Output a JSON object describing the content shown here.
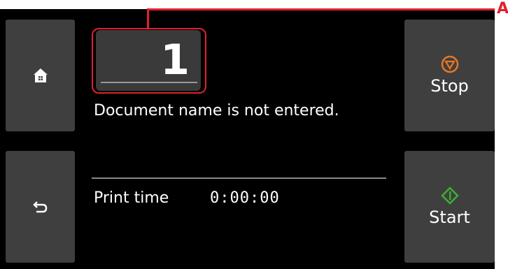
{
  "buttons": {
    "home": {
      "icon": "home-icon"
    },
    "back": {
      "icon": "back-icon"
    },
    "stop": {
      "label": "Stop",
      "icon": "stop-icon",
      "color": "#e87722"
    },
    "start": {
      "label": "Start",
      "icon": "start-icon",
      "color": "#3cb034"
    }
  },
  "copies": {
    "value": "1"
  },
  "document": {
    "message": "Document name is not entered."
  },
  "print_time": {
    "label": "Print time",
    "value": "0:00:00"
  },
  "callout": {
    "letter": "A",
    "color": "#e2202c"
  }
}
